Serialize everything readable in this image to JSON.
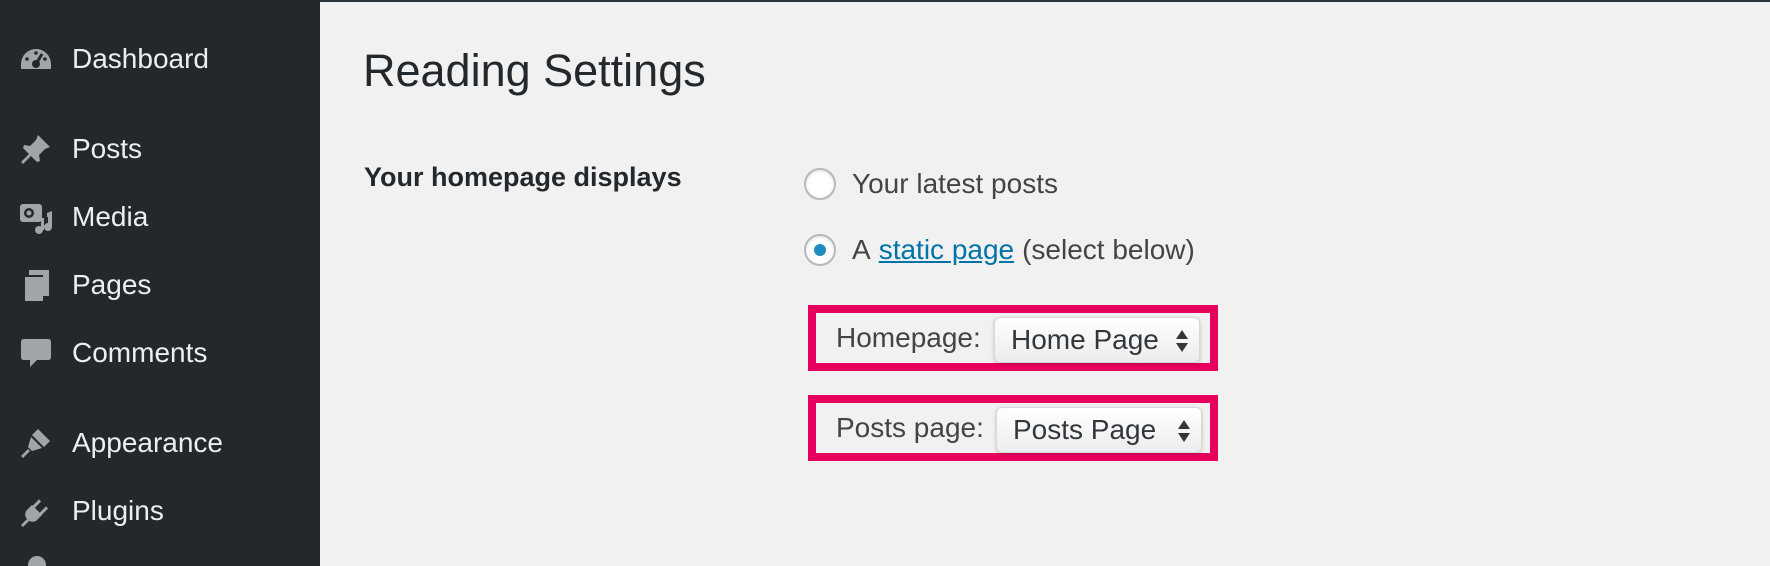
{
  "sidebar": {
    "items": [
      {
        "label": "Dashboard",
        "icon": "dashboard-icon"
      },
      {
        "label": "Posts",
        "icon": "pin-icon"
      },
      {
        "label": "Media",
        "icon": "media-icon"
      },
      {
        "label": "Pages",
        "icon": "pages-icon"
      },
      {
        "label": "Comments",
        "icon": "comment-icon"
      },
      {
        "label": "Appearance",
        "icon": "paintbrush-icon"
      },
      {
        "label": "Plugins",
        "icon": "plugin-icon"
      }
    ]
  },
  "main": {
    "title": "Reading Settings",
    "homepage_displays": {
      "label": "Your homepage displays",
      "options": [
        {
          "label": "Your latest posts",
          "checked": false
        },
        {
          "label_prefix": "A",
          "link": "static page",
          "label_suffix": "(select below)",
          "checked": true
        }
      ],
      "homepage": {
        "label": "Homepage:",
        "selected": "Home Page"
      },
      "posts_page": {
        "label": "Posts page:",
        "selected": "Posts Page"
      }
    }
  },
  "colors": {
    "sidebar_bg": "#23282d",
    "page_bg": "#f1f1f1",
    "link": "#0073aa",
    "radio_checked": "#1e8cbe",
    "highlight": "#e8005f"
  }
}
